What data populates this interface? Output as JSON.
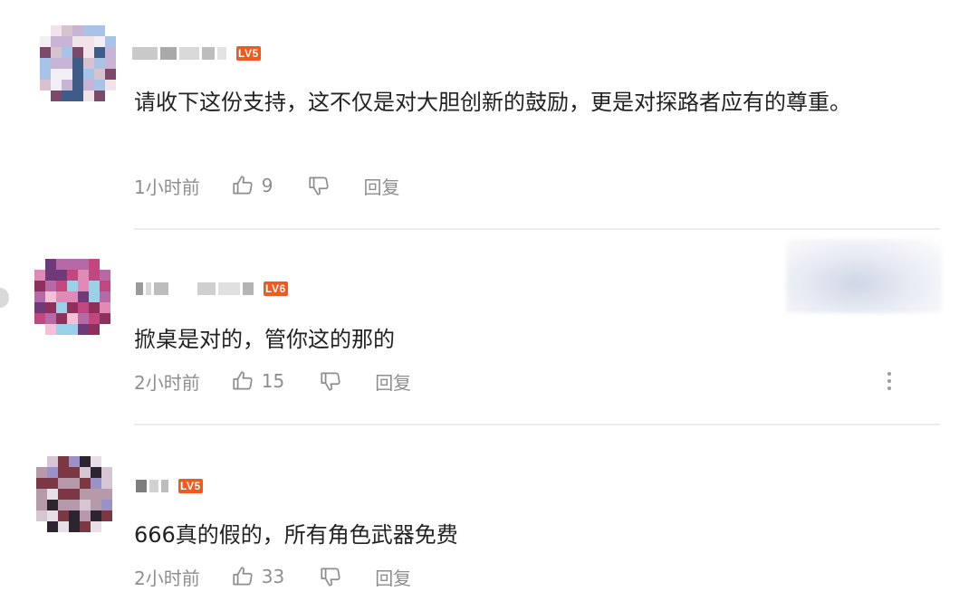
{
  "comments": [
    {
      "level": "LV5",
      "text": "请收下这份支持，这不仅是对大胆创新的鼓励，更是对探路者应有的尊重。",
      "time": "1小时前",
      "likes": "9",
      "reply": "回复",
      "avatar_palette": [
        "#f2e3e8",
        "#d8c2cf",
        "#3e5c86",
        "#7b4a6a",
        "#c8b5d6",
        "#f1eef4",
        "#a7c4e8"
      ]
    },
    {
      "level": "LV6",
      "text": "掀桌是对的，管你这的那的",
      "time": "2小时前",
      "likes": "15",
      "reply": "回复",
      "avatar_palette": [
        "#c1477e",
        "#e08ab7",
        "#6e3a77",
        "#f3c0d8",
        "#b56aa6",
        "#8f2f5b",
        "#9ad0e8"
      ]
    },
    {
      "level": "LV5",
      "text": "666真的假的，所有角色武器免费",
      "time": "2小时前",
      "likes": "33",
      "reply": "回复",
      "avatar_palette": [
        "#4a3b46",
        "#b79aa9",
        "#7c3745",
        "#e8dfe6",
        "#9a92c7",
        "#2e2430",
        "#d6c5d2"
      ]
    }
  ],
  "icons": {
    "like": "thumb-up-icon",
    "dislike": "thumb-down-icon",
    "more": "more-vertical-icon"
  },
  "colors": {
    "badge": "#f05a1e",
    "meta_text": "#8e8e8e",
    "divider": "#ececec"
  }
}
